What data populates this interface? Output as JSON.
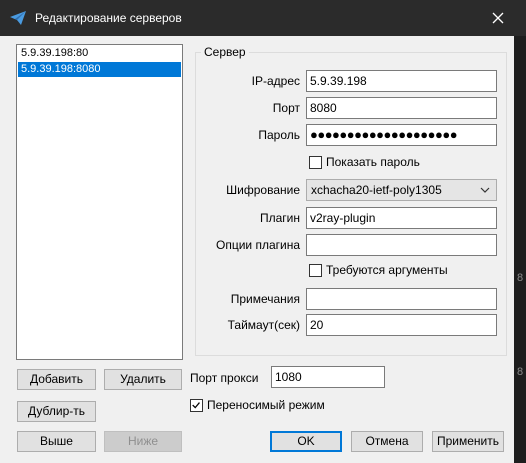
{
  "window": {
    "title": "Редактирование серверов"
  },
  "servers": {
    "items": [
      {
        "label": "5.9.39.198:80",
        "selected": false
      },
      {
        "label": "5.9.39.198:8080",
        "selected": true
      }
    ]
  },
  "server_group": {
    "title": "Сервер",
    "ip_label": "IP-адрес",
    "ip_value": "5.9.39.198",
    "port_label": "Порт",
    "port_value": "8080",
    "password_label": "Пароль",
    "password_value": "●●●●●●●●●●●●●●●●●●●●",
    "show_password_label": "Показать пароль",
    "show_password_checked": false,
    "encryption_label": "Шифрование",
    "encryption_value": "xchacha20-ietf-poly1305",
    "plugin_label": "Плагин",
    "plugin_value": "v2ray-plugin",
    "plugin_options_label": "Опции плагина",
    "plugin_options_value": "",
    "requires_args_label": "Требуются аргументы",
    "requires_args_checked": false,
    "notes_label": "Примечания",
    "notes_value": "",
    "timeout_label": "Таймаут(сек)",
    "timeout_value": "20"
  },
  "buttons": {
    "add": "Добавить",
    "delete": "Удалить",
    "duplicate": "Дублир-ть",
    "up": "Выше",
    "down": "Ниже",
    "ok": "OK",
    "cancel": "Отмена",
    "apply": "Применить"
  },
  "proxy": {
    "port_label": "Порт прокси",
    "port_value": "1080",
    "portable_label": "Переносимый режим",
    "portable_checked": true
  },
  "background_edge": {
    "frag1": "8",
    "frag2": "8"
  },
  "colors": {
    "accent": "#0078d7",
    "titlebar": "#2b2b2b",
    "dialog": "#f0f0f0"
  }
}
